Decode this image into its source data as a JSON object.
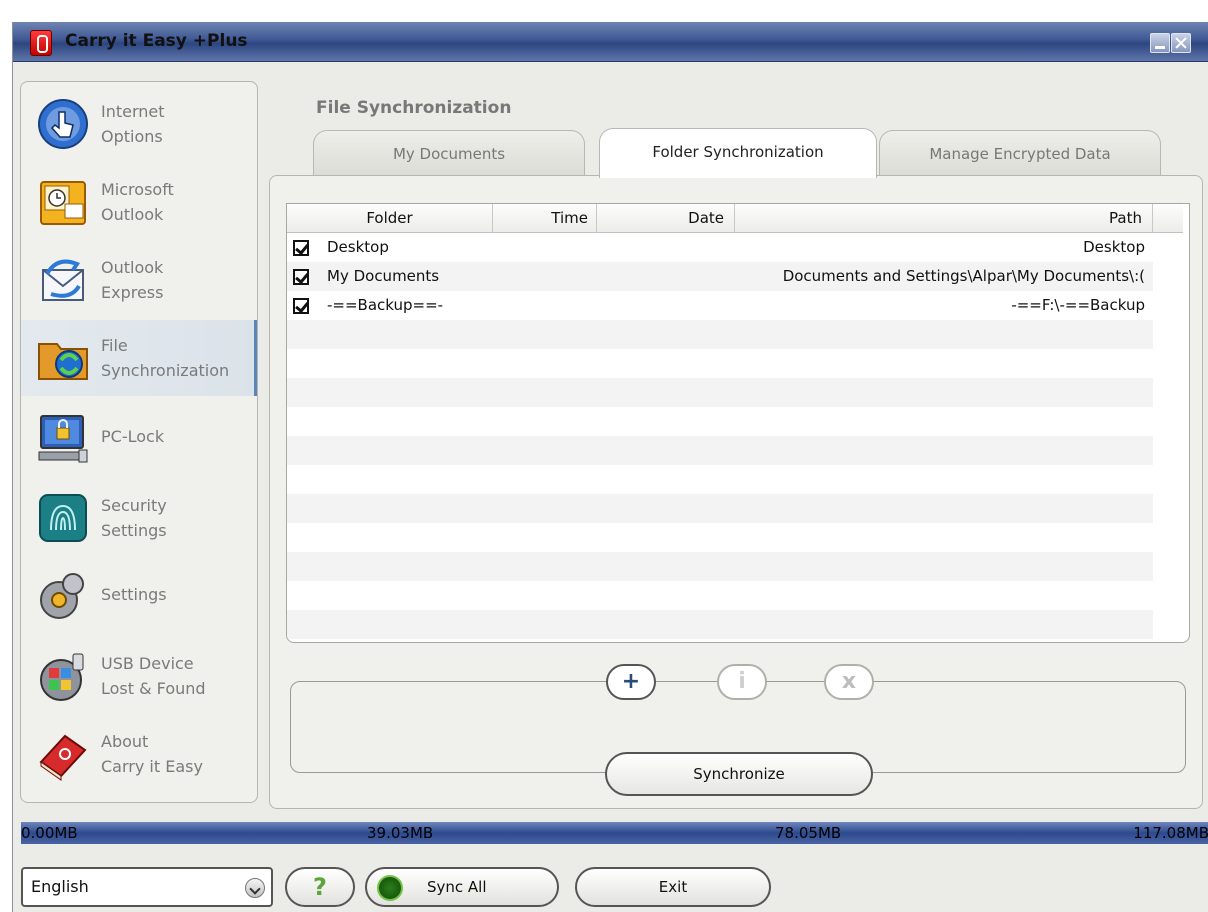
{
  "window": {
    "title": "Carry it Easy +Plus"
  },
  "sidebar": {
    "items": [
      {
        "label1": "Internet",
        "label2": "Options",
        "icon": "internet-options-icon"
      },
      {
        "label1": "Microsoft",
        "label2": "Outlook",
        "icon": "outlook-icon"
      },
      {
        "label1": "Outlook",
        "label2": "Express",
        "icon": "outlook-express-icon"
      },
      {
        "label1": "File",
        "label2": "Synchronization",
        "icon": "file-sync-icon",
        "active": true
      },
      {
        "label1": "PC-Lock",
        "label2": "",
        "icon": "pc-lock-icon"
      },
      {
        "label1": "Security",
        "label2": "Settings",
        "icon": "fingerprint-icon"
      },
      {
        "label1": "Settings",
        "label2": "",
        "icon": "settings-gear-icon"
      },
      {
        "label1": "USB Device",
        "label2": "Lost & Found",
        "icon": "usb-device-icon"
      },
      {
        "label1": "About",
        "label2": "Carry it Easy",
        "icon": "about-book-icon"
      }
    ]
  },
  "main": {
    "section_title": "File Synchronization",
    "tabs": [
      "My Documents",
      "Folder Synchronization",
      "Manage Encrypted Data"
    ],
    "active_tab": "Folder Synchronization",
    "table": {
      "columns": [
        "Folder",
        "Time",
        "Date",
        "Path"
      ],
      "rows": [
        {
          "checked": true,
          "folder": "Desktop",
          "time": "",
          "date": "",
          "path": "Desktop"
        },
        {
          "checked": true,
          "folder": "My Documents",
          "time": "",
          "date": "",
          "path": "):\\Documents and Settings\\Alpar\\My Documents"
        },
        {
          "checked": true,
          "folder": "-==Backup==-",
          "time": "",
          "date": "",
          "path": "F:\\-==Backup==-"
        }
      ]
    },
    "actions": {
      "add": "+",
      "info": "i",
      "remove": "x",
      "synchronize": "Synchronize"
    }
  },
  "storage": {
    "ticks": [
      "0.00MB",
      "39.03MB",
      "78.05MB",
      "117.08MB"
    ]
  },
  "footer": {
    "language": "English",
    "help": "?",
    "sync_all": "Sync All",
    "exit": "Exit"
  },
  "colors": {
    "titlebar": "#3f5894",
    "storage_bar": "#2d4a8e",
    "active_item_accent": "#5b84b8"
  }
}
